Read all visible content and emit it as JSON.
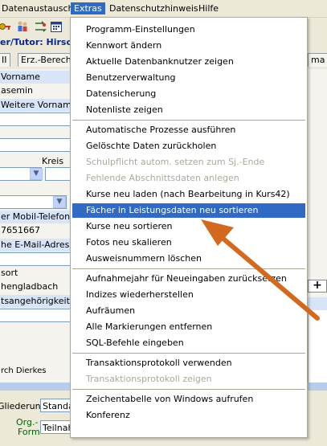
{
  "menubar": {
    "items": [
      {
        "label": "Datenaustausch"
      },
      {
        "label": "Extras"
      },
      {
        "label": "Datenschutzhinweis"
      },
      {
        "label": "Hilfe"
      }
    ]
  },
  "toolbar": {
    "icons": [
      "key-icon",
      "people-icon",
      "transfer-icon",
      "calendar-icon"
    ]
  },
  "title_strip": "er/Tutor: Hirsch",
  "tabs": [
    {
      "label": "II"
    },
    {
      "label": "Erz.-Berecht"
    },
    {
      "label": "ma"
    }
  ],
  "form": {
    "vorname_label": "Vorname",
    "vorname_value": "asemin",
    "weitere_label": "Weitere Vornamen",
    "kreis_label": "Kreis",
    "mobil_label": "er Mobil-Telefon",
    "mobil_value": "7651667",
    "email_label": "he E-Mail-Adresse",
    "ort_label": "sort",
    "ort_value": "hengladbach",
    "staats_label": "tsangehörigkeit",
    "author_text": "rch Dierkes"
  },
  "bottom": {
    "gliederung_label": "Gliederung",
    "gliederung_value": "Standa",
    "org_label": "Org.-",
    "form_label": "Form",
    "org_value": "Teilnah",
    "plus_label": "+"
  },
  "extras_menu": {
    "groups": [
      [
        {
          "label": "Programm-Einstellungen",
          "disabled": false
        },
        {
          "label": "Kennwort ändern",
          "disabled": false
        },
        {
          "label": "Aktuelle Datenbanknutzer zeigen",
          "disabled": false
        },
        {
          "label": "Benutzerverwaltung",
          "disabled": false
        },
        {
          "label": "Datensicherung",
          "disabled": false
        },
        {
          "label": "Notenliste zeigen",
          "disabled": false
        }
      ],
      [
        {
          "label": "Automatische Prozesse ausführen",
          "disabled": false
        },
        {
          "label": "Gelöschte Daten zurückholen",
          "disabled": false
        },
        {
          "label": "Schulpflicht autom. setzen zum Sj.-Ende",
          "disabled": true
        },
        {
          "label": "Fehlende Abschnittsdaten anlegen",
          "disabled": true
        },
        {
          "label": "Kurse neu laden (nach Bearbeitung in Kurs42)",
          "disabled": false
        },
        {
          "label": "Fächer in Leistungsdaten neu sortieren",
          "disabled": false,
          "highlight": true
        },
        {
          "label": "Kurse neu sortieren",
          "disabled": false
        },
        {
          "label": "Fotos neu skalieren",
          "disabled": false
        },
        {
          "label": "Ausweisnummern löschen",
          "disabled": false
        }
      ],
      [
        {
          "label": "Aufnahmejahr für Neueingaben zurücksetzen",
          "disabled": false
        },
        {
          "label": "Indizes wiederherstellen",
          "disabled": false
        },
        {
          "label": "Aufräumen",
          "disabled": false
        },
        {
          "label": "Alle Markierungen entfernen",
          "disabled": false
        },
        {
          "label": "SQL-Befehle eingeben",
          "disabled": false
        }
      ],
      [
        {
          "label": "Transaktionsprotokoll verwenden",
          "disabled": false
        },
        {
          "label": "Transaktionsprotokoll zeigen",
          "disabled": true
        }
      ],
      [
        {
          "label": "Zeichentabelle von Windows aufrufen",
          "disabled": false
        },
        {
          "label": "Konferenz",
          "disabled": false
        }
      ]
    ]
  },
  "annotation": {
    "arrow_color": "#d2691e",
    "arrow_target": "Fächer in Leistungsdaten neu sortieren"
  },
  "colors": {
    "menu_highlight": "#316ac5",
    "disabled_text": "#aca899",
    "title_text": "#0a2a8a"
  }
}
